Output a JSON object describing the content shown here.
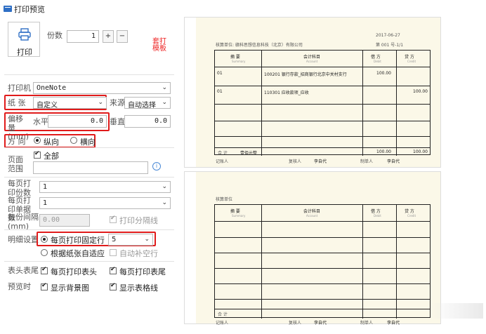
{
  "window": {
    "title": "打印预览"
  },
  "print_button": {
    "label": "打印",
    "icon": "printer-icon"
  },
  "copies": {
    "label": "份数",
    "value": "1",
    "plus": "+",
    "minus": "−"
  },
  "template_link": "套打模板",
  "printer": {
    "label": "打印机",
    "value": "OneNote"
  },
  "paper": {
    "label": "纸  张",
    "value": "自定义",
    "source_label": "来源",
    "source_value": "自动选择"
  },
  "offset": {
    "label": "偏移量(mm)",
    "horizontal_label": "水平",
    "horizontal_value": "0.0",
    "vertical_label": "垂直",
    "vertical_value": "0.0"
  },
  "orientation": {
    "label": "方  向",
    "portrait": "纵向",
    "landscape": "横向",
    "selected": "portrait"
  },
  "page_range": {
    "label": "页面范围",
    "all_label": "全部",
    "all_checked": true,
    "input_value": ""
  },
  "copies_per_page": {
    "label": "每页打印份数",
    "value": "1"
  },
  "docs_per_page": {
    "label": "每页打印单据数",
    "value": "1"
  },
  "gap": {
    "label": "每份间隔(mm)",
    "value": "0.00",
    "divider_label": "打印分隔线",
    "divider_checked": true
  },
  "detail": {
    "label": "明细设置",
    "fixed_rows_label": "每页打印固定行",
    "fixed_rows_value": "5",
    "auto_fit_label": "根据纸张自适应",
    "auto_fill_label": "自动补空行",
    "selected": "fixed"
  },
  "header_footer": {
    "label": "表头表尾",
    "header_label": "每页打印表头",
    "footer_label": "每页打印表尾"
  },
  "preview": {
    "label": "预览时",
    "bg_label": "显示背景图",
    "grid_label": "显示表格线"
  },
  "voucher1": {
    "unit": "核算单位: 赣科思想信息科技（北京）有限公司",
    "doc_no": "第  001  号-1/1",
    "date": "2017-06-27",
    "header": [
      "摘 要",
      "会计科目",
      "借 方",
      "贷 方"
    ],
    "header_en": [
      "Summary",
      "Account",
      "Debit",
      "Credit"
    ],
    "rows": [
      {
        "summary": "01",
        "account": "100201 银行存款_招商银行北京中关村支行",
        "debit": "100.00",
        "credit": ""
      },
      {
        "summary": "01",
        "account": "110301 应收款项_应收",
        "debit": "",
        "credit": "100.00"
      }
    ],
    "total_label": "合 计",
    "total_text": "壹佰元整",
    "total_debit": "100.00",
    "total_credit": "100.00",
    "signers": [
      "记账人",
      "复核人",
      "李自代",
      "制单人",
      "李自代"
    ]
  },
  "voucher2": {
    "unit": "核算单位",
    "header": [
      "摘 要",
      "会计科目",
      "借 方",
      "贷 方"
    ],
    "header_en": [
      "Summary",
      "Account",
      "Debit",
      "Credit"
    ],
    "total_label": "合 计",
    "signers": [
      "记账人",
      "复核人",
      "李自代",
      "制单人",
      "李自代"
    ]
  },
  "colors": {
    "highlight": "#e01b1b",
    "accent": "#2f6fc5",
    "paper": "#fbf8e8"
  }
}
